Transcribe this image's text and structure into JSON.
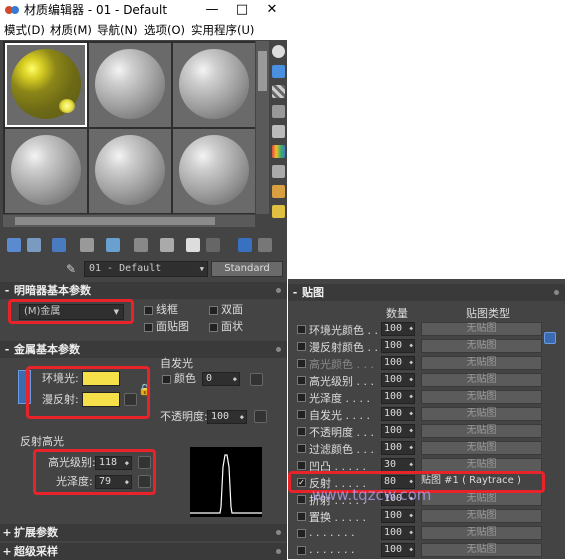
{
  "window": {
    "title": "材质编辑器 - 01 - Default",
    "btn_min": "—",
    "btn_max": "□",
    "btn_close": "✕"
  },
  "menu": [
    "模式(D)",
    "材质(M)",
    "导航(N)",
    "选项(O)",
    "实用程序(U)"
  ],
  "slots": 6,
  "material": {
    "name": "01 - Default",
    "type_button": "Standard"
  },
  "shader": {
    "header": "明暗器基本参数",
    "selected": "(M)金属",
    "opt_wire": "线框",
    "opt_twosided": "双面",
    "opt_facemap": "面贴图",
    "opt_faceted": "面状"
  },
  "metal": {
    "header": "金属基本参数",
    "ambient_label": "环境光:",
    "diffuse_label": "漫反射:",
    "selfillum_header": "自发光",
    "selfillum_color": "颜色",
    "selfillum_value": "0",
    "opacity_label": "不透明度:",
    "opacity_value": "100",
    "specular_header": "反射高光",
    "spec_level_label": "高光级别:",
    "spec_level_value": "118",
    "gloss_label": "光泽度:",
    "gloss_value": "79",
    "swatch_color": "#f5e04a"
  },
  "rollouts": {
    "extended": "扩展参数",
    "supersampling": "超级采样"
  },
  "maps": {
    "header": "贴图",
    "col_amount": "数量",
    "col_type": "贴图类型",
    "none_label": "无贴图",
    "rows": [
      {
        "label": "环境光颜色 . .",
        "amount": "100",
        "map": "无贴图",
        "enabled": true,
        "checked": false
      },
      {
        "label": "漫反射颜色 . .",
        "amount": "100",
        "map": "无贴图",
        "enabled": true,
        "checked": false
      },
      {
        "label": "高光颜色 . . .",
        "amount": "100",
        "map": "无贴图",
        "enabled": false,
        "checked": false
      },
      {
        "label": "高光级别 . . .",
        "amount": "100",
        "map": "无贴图",
        "enabled": true,
        "checked": false
      },
      {
        "label": "光泽度 . . . .",
        "amount": "100",
        "map": "无贴图",
        "enabled": true,
        "checked": false
      },
      {
        "label": "自发光 . . . .",
        "amount": "100",
        "map": "无贴图",
        "enabled": true,
        "checked": false
      },
      {
        "label": "不透明度 . . .",
        "amount": "100",
        "map": "无贴图",
        "enabled": true,
        "checked": false
      },
      {
        "label": "过滤颜色 . . .",
        "amount": "100",
        "map": "无贴图",
        "enabled": true,
        "checked": false
      },
      {
        "label": "凹凸 . . . . .",
        "amount": "30",
        "map": "无贴图",
        "enabled": true,
        "checked": false
      },
      {
        "label": "反射 . . . . .",
        "amount": "80",
        "map": "贴图 #1  ( Raytrace )",
        "enabled": true,
        "checked": true
      },
      {
        "label": "折射 . . . . .",
        "amount": "100",
        "map": "无贴图",
        "enabled": true,
        "checked": false
      },
      {
        "label": "置换 . . . . .",
        "amount": "100",
        "map": "无贴图",
        "enabled": true,
        "checked": false
      },
      {
        "label": ". . . . . . .",
        "amount": "100",
        "map": "无贴图",
        "enabled": true,
        "checked": false
      },
      {
        "label": ". . . . . . .",
        "amount": "100",
        "map": "无贴图",
        "enabled": true,
        "checked": false
      }
    ]
  },
  "watermark": "www.tqzcw.com"
}
